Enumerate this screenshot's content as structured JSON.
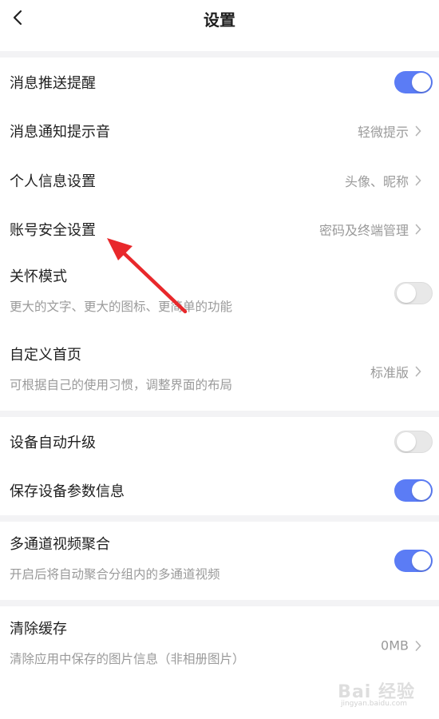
{
  "header": {
    "title": "设置"
  },
  "group1": {
    "push": {
      "label": "消息推送提醒",
      "toggle": "on"
    },
    "sound": {
      "label": "消息通知提示音",
      "value": "轻微提示"
    },
    "profile": {
      "label": "个人信息设置",
      "value": "头像、昵称"
    },
    "security": {
      "label": "账号安全设置",
      "value": "密码及终端管理"
    },
    "care": {
      "label": "关怀模式",
      "sub": "更大的文字、更大的图标、更简单的功能",
      "toggle": "off"
    },
    "home": {
      "label": "自定义首页",
      "sub": "可根据自己的使用习惯，调整界面的布局",
      "value": "标准版"
    }
  },
  "group2": {
    "upgrade": {
      "label": "设备自动升级",
      "toggle": "off"
    },
    "params": {
      "label": "保存设备参数信息",
      "toggle": "on"
    }
  },
  "group3": {
    "multichannel": {
      "label": "多通道视频聚合",
      "sub": "开启后将自动聚合分组内的多通道视频",
      "toggle": "on"
    }
  },
  "group4": {
    "cache": {
      "label": "清除缓存",
      "sub": "清除应用中保存的图片信息（非相册图片）",
      "value": "0MB"
    }
  },
  "watermark": {
    "text": "Bai 经验",
    "sub": "jingyan.baidu.com"
  },
  "colors": {
    "toggle_on": "#5b7cf5",
    "toggle_off": "#e8e8e8",
    "arrow": "#e8282b"
  }
}
